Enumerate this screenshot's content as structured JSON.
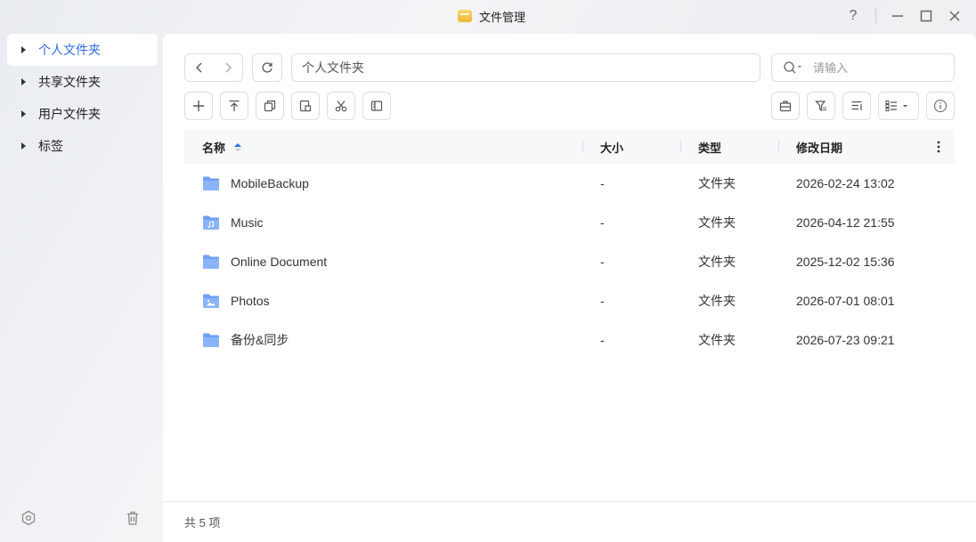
{
  "window": {
    "title": "文件管理",
    "controls": {
      "help": "?",
      "minimize": "—",
      "maximize": "□",
      "close": "✕"
    }
  },
  "sidebar": {
    "items": [
      {
        "label": "个人文件夹",
        "active": true
      },
      {
        "label": "共享文件夹",
        "active": false
      },
      {
        "label": "用户文件夹",
        "active": false
      },
      {
        "label": "标签",
        "active": false
      }
    ],
    "bottom_icons": [
      "hexagon-icon",
      "trash-icon"
    ]
  },
  "toolbar": {
    "path_value": "个人文件夹",
    "search_placeholder": "请输入",
    "action_icons": [
      "plus-icon",
      "upload-icon",
      "copy-icon",
      "move-icon",
      "cut-icon",
      "compress-icon"
    ],
    "right_icons": [
      "briefcase-icon",
      "filter-icon",
      "sort-icon",
      "view-list-icon",
      "info-icon"
    ]
  },
  "table": {
    "columns": {
      "name": "名称",
      "size": "大小",
      "type": "类型",
      "modified": "修改日期"
    },
    "rows": [
      {
        "name": "MobileBackup",
        "size": "-",
        "type": "文件夹",
        "modified": "2026-02-24 13:02",
        "icon": "folder-icon"
      },
      {
        "name": "Music",
        "size": "-",
        "type": "文件夹",
        "modified": "2026-04-12 21:55",
        "icon": "music-folder-icon"
      },
      {
        "name": "Online Document",
        "size": "-",
        "type": "文件夹",
        "modified": "2025-12-02 15:36",
        "icon": "folder-icon"
      },
      {
        "name": "Photos",
        "size": "-",
        "type": "文件夹",
        "modified": "2026-07-01 08:01",
        "icon": "photo-folder-icon"
      },
      {
        "name": "备份&同步",
        "size": "-",
        "type": "文件夹",
        "modified": "2026-07-23 09:21",
        "icon": "folder-icon"
      }
    ]
  },
  "footer": {
    "count_text": "共 5 项"
  },
  "colors": {
    "accent": "#2f6ce5",
    "folder": "#6f9ff5",
    "folder_tab": "#8bb3fa"
  }
}
